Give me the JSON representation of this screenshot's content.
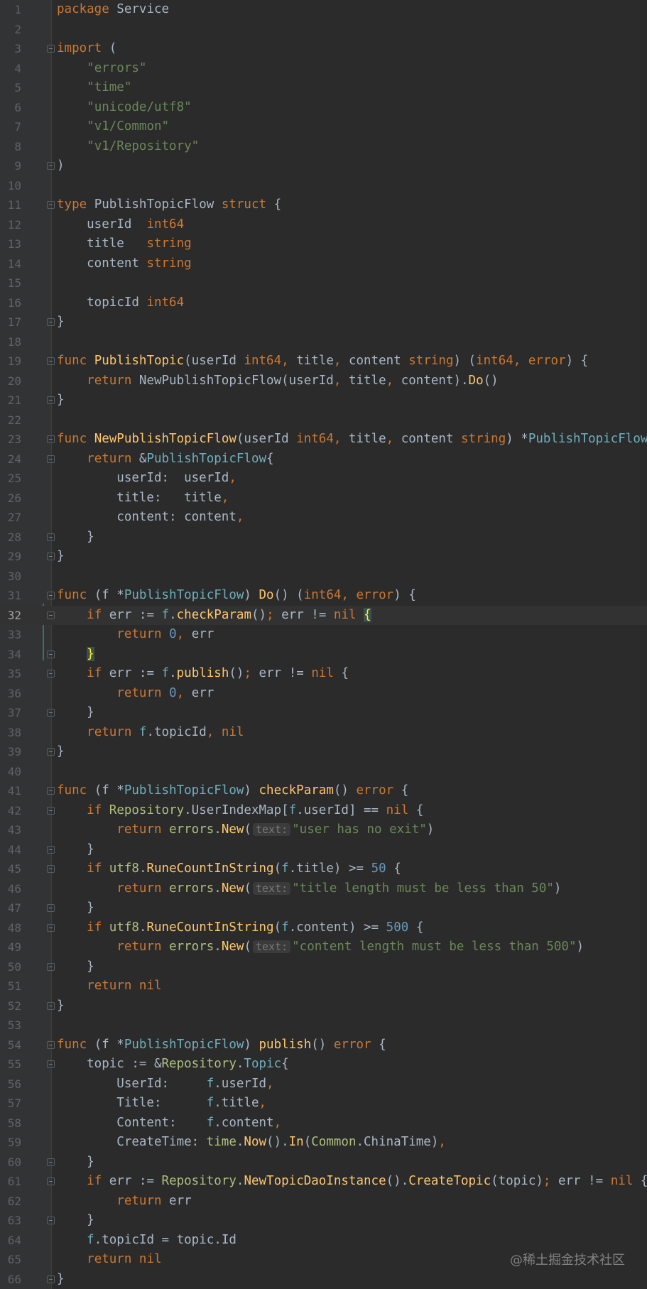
{
  "current_line": 32,
  "watermark": "@稀土掘金技术社区",
  "colors": {
    "background": "#2b2b2b",
    "keyword": "#cc7832",
    "function": "#ffc66d",
    "string": "#6a8759",
    "number": "#6897bb",
    "default": "#a9b7c6"
  },
  "lines": [
    {
      "n": "1",
      "tokens": [
        [
          "kw",
          "package"
        ],
        [
          "t",
          " Service"
        ]
      ]
    },
    {
      "n": "2",
      "tokens": []
    },
    {
      "n": "3",
      "fold": true,
      "tokens": [
        [
          "kw",
          "import"
        ],
        [
          "t",
          " ("
        ]
      ]
    },
    {
      "n": "4",
      "tokens": [
        [
          "t",
          "    "
        ],
        [
          "str",
          "\"errors\""
        ]
      ]
    },
    {
      "n": "5",
      "tokens": [
        [
          "t",
          "    "
        ],
        [
          "str",
          "\"time\""
        ]
      ]
    },
    {
      "n": "6",
      "tokens": [
        [
          "t",
          "    "
        ],
        [
          "str",
          "\"unicode/utf8\""
        ]
      ]
    },
    {
      "n": "7",
      "tokens": [
        [
          "t",
          "    "
        ],
        [
          "str",
          "\"v1/Common\""
        ]
      ]
    },
    {
      "n": "8",
      "tokens": [
        [
          "t",
          "    "
        ],
        [
          "str",
          "\"v1/Repository\""
        ]
      ]
    },
    {
      "n": "9",
      "fold": true,
      "tokens": [
        [
          "t",
          ")"
        ]
      ]
    },
    {
      "n": "10",
      "tokens": []
    },
    {
      "n": "11",
      "fold": true,
      "tokens": [
        [
          "kw",
          "type"
        ],
        [
          "t",
          " PublishTopicFlow "
        ],
        [
          "kw",
          "struct"
        ],
        [
          "t",
          " {"
        ]
      ]
    },
    {
      "n": "12",
      "tokens": [
        [
          "t",
          "    userId  "
        ],
        [
          "ty",
          "int64"
        ]
      ]
    },
    {
      "n": "13",
      "tokens": [
        [
          "t",
          "    title   "
        ],
        [
          "ty",
          "string"
        ]
      ]
    },
    {
      "n": "14",
      "tokens": [
        [
          "t",
          "    content "
        ],
        [
          "ty",
          "string"
        ]
      ]
    },
    {
      "n": "15",
      "tokens": []
    },
    {
      "n": "16",
      "tokens": [
        [
          "t",
          "    topicId "
        ],
        [
          "ty",
          "int64"
        ]
      ]
    },
    {
      "n": "17",
      "fold": true,
      "tokens": [
        [
          "t",
          "}"
        ]
      ]
    },
    {
      "n": "18",
      "tokens": []
    },
    {
      "n": "19",
      "fold": true,
      "tokens": [
        [
          "kw",
          "func"
        ],
        [
          "t",
          " "
        ],
        [
          "fn",
          "PublishTopic"
        ],
        [
          "t",
          "(userId "
        ],
        [
          "ty",
          "int64"
        ],
        [
          "kw",
          ","
        ],
        [
          "t",
          " title"
        ],
        [
          "kw",
          ","
        ],
        [
          "t",
          " content "
        ],
        [
          "ty",
          "string"
        ],
        [
          "t",
          ") ("
        ],
        [
          "ty",
          "int64"
        ],
        [
          "kw",
          ","
        ],
        [
          "t",
          " "
        ],
        [
          "ty",
          "error"
        ],
        [
          "t",
          ") {"
        ]
      ]
    },
    {
      "n": "20",
      "tokens": [
        [
          "t",
          "    "
        ],
        [
          "kw",
          "return"
        ],
        [
          "t",
          " NewPublishTopicFlow(userId"
        ],
        [
          "kw",
          ","
        ],
        [
          "t",
          " title"
        ],
        [
          "kw",
          ","
        ],
        [
          "t",
          " content)."
        ],
        [
          "fn",
          "Do"
        ],
        [
          "t",
          "()"
        ]
      ]
    },
    {
      "n": "21",
      "fold": true,
      "tokens": [
        [
          "t",
          "}"
        ]
      ]
    },
    {
      "n": "22",
      "tokens": []
    },
    {
      "n": "23",
      "fold": true,
      "tokens": [
        [
          "kw",
          "func"
        ],
        [
          "t",
          " "
        ],
        [
          "fn",
          "NewPublishTopicFlow"
        ],
        [
          "t",
          "(userId "
        ],
        [
          "ty",
          "int64"
        ],
        [
          "kw",
          ","
        ],
        [
          "t",
          " title"
        ],
        [
          "kw",
          ","
        ],
        [
          "t",
          " content "
        ],
        [
          "ty",
          "string"
        ],
        [
          "t",
          ") *"
        ],
        [
          "type-ref",
          "PublishTopicFlow"
        ],
        [
          "t",
          " {"
        ]
      ]
    },
    {
      "n": "24",
      "fold": true,
      "tokens": [
        [
          "t",
          "    "
        ],
        [
          "kw",
          "return"
        ],
        [
          "t",
          " &"
        ],
        [
          "type-ref",
          "PublishTopicFlow"
        ],
        [
          "t",
          "{"
        ]
      ]
    },
    {
      "n": "25",
      "tokens": [
        [
          "t",
          "        userId:  userId"
        ],
        [
          "kw",
          ","
        ]
      ]
    },
    {
      "n": "26",
      "tokens": [
        [
          "t",
          "        title:   title"
        ],
        [
          "kw",
          ","
        ]
      ]
    },
    {
      "n": "27",
      "tokens": [
        [
          "t",
          "        content: content"
        ],
        [
          "kw",
          ","
        ]
      ]
    },
    {
      "n": "28",
      "fold": true,
      "tokens": [
        [
          "t",
          "    }"
        ]
      ]
    },
    {
      "n": "29",
      "fold": true,
      "tokens": [
        [
          "t",
          "}"
        ]
      ]
    },
    {
      "n": "30",
      "tokens": []
    },
    {
      "n": "31",
      "fold": true,
      "tokens": [
        [
          "kw",
          "func"
        ],
        [
          "t",
          " (f *"
        ],
        [
          "type-ref",
          "PublishTopicFlow"
        ],
        [
          "t",
          ") "
        ],
        [
          "fn",
          "Do"
        ],
        [
          "t",
          "() ("
        ],
        [
          "ty",
          "int64"
        ],
        [
          "kw",
          ","
        ],
        [
          "t",
          " "
        ],
        [
          "ty",
          "error"
        ],
        [
          "t",
          ") {"
        ]
      ]
    },
    {
      "n": "32",
      "fold": true,
      "tokens": [
        [
          "t",
          "    "
        ],
        [
          "kw",
          "if"
        ],
        [
          "t",
          " err := "
        ],
        [
          "type-ref",
          "f"
        ],
        [
          "t",
          "."
        ],
        [
          "fn",
          "checkParam"
        ],
        [
          "t",
          "()"
        ],
        [
          "kw",
          ";"
        ],
        [
          "t",
          " err != "
        ],
        [
          "kw",
          "nil"
        ],
        [
          "t",
          " "
        ],
        [
          "brace",
          "{"
        ]
      ]
    },
    {
      "n": "33",
      "tokens": [
        [
          "t",
          "        "
        ],
        [
          "kw",
          "return"
        ],
        [
          "t",
          " "
        ],
        [
          "num",
          "0"
        ],
        [
          "kw",
          ","
        ],
        [
          "t",
          " err"
        ]
      ]
    },
    {
      "n": "34",
      "fold": true,
      "tokens": [
        [
          "t",
          "    "
        ],
        [
          "brace",
          "}"
        ]
      ]
    },
    {
      "n": "35",
      "fold": true,
      "tokens": [
        [
          "t",
          "    "
        ],
        [
          "kw",
          "if"
        ],
        [
          "t",
          " err := "
        ],
        [
          "type-ref",
          "f"
        ],
        [
          "t",
          "."
        ],
        [
          "fn",
          "publish"
        ],
        [
          "t",
          "()"
        ],
        [
          "kw",
          ";"
        ],
        [
          "t",
          " err != "
        ],
        [
          "kw",
          "nil"
        ],
        [
          "t",
          " {"
        ]
      ]
    },
    {
      "n": "36",
      "tokens": [
        [
          "t",
          "        "
        ],
        [
          "kw",
          "return"
        ],
        [
          "t",
          " "
        ],
        [
          "num",
          "0"
        ],
        [
          "kw",
          ","
        ],
        [
          "t",
          " err"
        ]
      ]
    },
    {
      "n": "37",
      "fold": true,
      "tokens": [
        [
          "t",
          "    }"
        ]
      ]
    },
    {
      "n": "38",
      "tokens": [
        [
          "t",
          "    "
        ],
        [
          "kw",
          "return"
        ],
        [
          "t",
          " "
        ],
        [
          "type-ref",
          "f"
        ],
        [
          "t",
          ".topicId"
        ],
        [
          "kw",
          ","
        ],
        [
          "t",
          " "
        ],
        [
          "kw",
          "nil"
        ]
      ]
    },
    {
      "n": "39",
      "fold": true,
      "tokens": [
        [
          "t",
          "}"
        ]
      ]
    },
    {
      "n": "40",
      "tokens": []
    },
    {
      "n": "41",
      "fold": true,
      "tokens": [
        [
          "kw",
          "func"
        ],
        [
          "t",
          " (f *"
        ],
        [
          "type-ref",
          "PublishTopicFlow"
        ],
        [
          "t",
          ") "
        ],
        [
          "fn",
          "checkParam"
        ],
        [
          "t",
          "() "
        ],
        [
          "ty",
          "error"
        ],
        [
          "t",
          " {"
        ]
      ]
    },
    {
      "n": "42",
      "fold": true,
      "tokens": [
        [
          "t",
          "    "
        ],
        [
          "kw",
          "if"
        ],
        [
          "t",
          " "
        ],
        [
          "pkg",
          "Repository"
        ],
        [
          "t",
          ".UserIndexMap["
        ],
        [
          "type-ref",
          "f"
        ],
        [
          "t",
          ".userId] == "
        ],
        [
          "kw",
          "nil"
        ],
        [
          "t",
          " {"
        ]
      ]
    },
    {
      "n": "43",
      "tokens": [
        [
          "t",
          "        "
        ],
        [
          "kw",
          "return"
        ],
        [
          "t",
          " "
        ],
        [
          "pkg",
          "errors"
        ],
        [
          "t",
          "."
        ],
        [
          "fn",
          "New"
        ],
        [
          "t",
          "("
        ],
        [
          "hint",
          "text:"
        ],
        [
          "str",
          "\"user has no exit\""
        ],
        [
          "t",
          ")"
        ]
      ]
    },
    {
      "n": "44",
      "fold": true,
      "tokens": [
        [
          "t",
          "    }"
        ]
      ]
    },
    {
      "n": "45",
      "fold": true,
      "tokens": [
        [
          "t",
          "    "
        ],
        [
          "kw",
          "if"
        ],
        [
          "t",
          " "
        ],
        [
          "pkg",
          "utf8"
        ],
        [
          "t",
          "."
        ],
        [
          "fn",
          "RuneCountInString"
        ],
        [
          "t",
          "("
        ],
        [
          "type-ref",
          "f"
        ],
        [
          "t",
          ".title) >= "
        ],
        [
          "num",
          "50"
        ],
        [
          "t",
          " {"
        ]
      ]
    },
    {
      "n": "46",
      "tokens": [
        [
          "t",
          "        "
        ],
        [
          "kw",
          "return"
        ],
        [
          "t",
          " "
        ],
        [
          "pkg",
          "errors"
        ],
        [
          "t",
          "."
        ],
        [
          "fn",
          "New"
        ],
        [
          "t",
          "("
        ],
        [
          "hint",
          "text:"
        ],
        [
          "str",
          "\"title length must be less than 50\""
        ],
        [
          "t",
          ")"
        ]
      ]
    },
    {
      "n": "47",
      "fold": true,
      "tokens": [
        [
          "t",
          "    }"
        ]
      ]
    },
    {
      "n": "48",
      "fold": true,
      "tokens": [
        [
          "t",
          "    "
        ],
        [
          "kw",
          "if"
        ],
        [
          "t",
          " "
        ],
        [
          "pkg",
          "utf8"
        ],
        [
          "t",
          "."
        ],
        [
          "fn",
          "RuneCountInString"
        ],
        [
          "t",
          "("
        ],
        [
          "type-ref",
          "f"
        ],
        [
          "t",
          ".content) >= "
        ],
        [
          "num",
          "500"
        ],
        [
          "t",
          " {"
        ]
      ]
    },
    {
      "n": "49",
      "tokens": [
        [
          "t",
          "        "
        ],
        [
          "kw",
          "return"
        ],
        [
          "t",
          " "
        ],
        [
          "pkg",
          "errors"
        ],
        [
          "t",
          "."
        ],
        [
          "fn",
          "New"
        ],
        [
          "t",
          "("
        ],
        [
          "hint",
          "text:"
        ],
        [
          "str",
          "\"content length must be less than 500\""
        ],
        [
          "t",
          ")"
        ]
      ]
    },
    {
      "n": "50",
      "fold": true,
      "tokens": [
        [
          "t",
          "    }"
        ]
      ]
    },
    {
      "n": "51",
      "tokens": [
        [
          "t",
          "    "
        ],
        [
          "kw",
          "return"
        ],
        [
          "t",
          " "
        ],
        [
          "kw",
          "nil"
        ]
      ]
    },
    {
      "n": "52",
      "fold": true,
      "tokens": [
        [
          "t",
          "}"
        ]
      ]
    },
    {
      "n": "53",
      "tokens": []
    },
    {
      "n": "54",
      "fold": true,
      "tokens": [
        [
          "kw",
          "func"
        ],
        [
          "t",
          " (f *"
        ],
        [
          "type-ref",
          "PublishTopicFlow"
        ],
        [
          "t",
          ") "
        ],
        [
          "fn",
          "publish"
        ],
        [
          "t",
          "() "
        ],
        [
          "ty",
          "error"
        ],
        [
          "t",
          " {"
        ]
      ]
    },
    {
      "n": "55",
      "fold": true,
      "tokens": [
        [
          "t",
          "    topic := &"
        ],
        [
          "pkg",
          "Repository"
        ],
        [
          "t",
          "."
        ],
        [
          "type-ref",
          "Topic"
        ],
        [
          "t",
          "{"
        ]
      ]
    },
    {
      "n": "56",
      "tokens": [
        [
          "t",
          "        UserId:     "
        ],
        [
          "type-ref",
          "f"
        ],
        [
          "t",
          ".userId"
        ],
        [
          "kw",
          ","
        ]
      ]
    },
    {
      "n": "57",
      "tokens": [
        [
          "t",
          "        Title:      "
        ],
        [
          "type-ref",
          "f"
        ],
        [
          "t",
          ".title"
        ],
        [
          "kw",
          ","
        ]
      ]
    },
    {
      "n": "58",
      "tokens": [
        [
          "t",
          "        Content:    "
        ],
        [
          "type-ref",
          "f"
        ],
        [
          "t",
          ".content"
        ],
        [
          "kw",
          ","
        ]
      ]
    },
    {
      "n": "59",
      "tokens": [
        [
          "t",
          "        CreateTime: "
        ],
        [
          "pkg",
          "time"
        ],
        [
          "t",
          "."
        ],
        [
          "fn",
          "Now"
        ],
        [
          "t",
          "()."
        ],
        [
          "fn",
          "In"
        ],
        [
          "t",
          "("
        ],
        [
          "pkg",
          "Common"
        ],
        [
          "t",
          ".ChinaTime)"
        ],
        [
          "kw",
          ","
        ]
      ]
    },
    {
      "n": "60",
      "fold": true,
      "tokens": [
        [
          "t",
          "    }"
        ]
      ]
    },
    {
      "n": "61",
      "fold": true,
      "tokens": [
        [
          "t",
          "    "
        ],
        [
          "kw",
          "if"
        ],
        [
          "t",
          " err := "
        ],
        [
          "pkg",
          "Repository"
        ],
        [
          "t",
          "."
        ],
        [
          "fn",
          "NewTopicDaoInstance"
        ],
        [
          "t",
          "()."
        ],
        [
          "fn",
          "CreateTopic"
        ],
        [
          "t",
          "(topic)"
        ],
        [
          "kw",
          ";"
        ],
        [
          "t",
          " err != "
        ],
        [
          "kw",
          "nil"
        ],
        [
          "t",
          " {"
        ]
      ]
    },
    {
      "n": "62",
      "tokens": [
        [
          "t",
          "        "
        ],
        [
          "kw",
          "return"
        ],
        [
          "t",
          " err"
        ]
      ]
    },
    {
      "n": "63",
      "fold": true,
      "tokens": [
        [
          "t",
          "    }"
        ]
      ]
    },
    {
      "n": "64",
      "tokens": [
        [
          "t",
          "    "
        ],
        [
          "type-ref",
          "f"
        ],
        [
          "t",
          ".topicId = topic.Id"
        ]
      ]
    },
    {
      "n": "65",
      "tokens": [
        [
          "t",
          "    "
        ],
        [
          "kw",
          "return"
        ],
        [
          "t",
          " "
        ],
        [
          "kw",
          "nil"
        ]
      ]
    },
    {
      "n": "66",
      "fold": true,
      "tokens": [
        [
          "t",
          "}"
        ]
      ]
    }
  ]
}
